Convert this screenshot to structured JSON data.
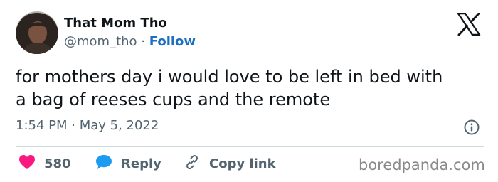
{
  "author": {
    "display_name": "That Mom Tho",
    "handle": "@mom_tho",
    "separator": "·",
    "follow_label": "Follow"
  },
  "tweet": {
    "lines": [
      "for mothers day i would love to be left in bed with",
      "a bag of reeses cups and the remote"
    ],
    "timestamp": "1:54 PM · May 5, 2022"
  },
  "actions": {
    "like_count": "580",
    "reply_label": "Reply",
    "copy_link_label": "Copy link"
  },
  "watermark": "boredpanda.com",
  "icons": {
    "platform": "x-logo-icon",
    "info": "info-icon",
    "like": "heart-icon",
    "reply": "speech-bubble-icon",
    "copy": "link-icon"
  },
  "colors": {
    "like": "#f91880",
    "reply": "#1d9bf0",
    "follow": "#1d6fbf",
    "muted": "#536471"
  }
}
